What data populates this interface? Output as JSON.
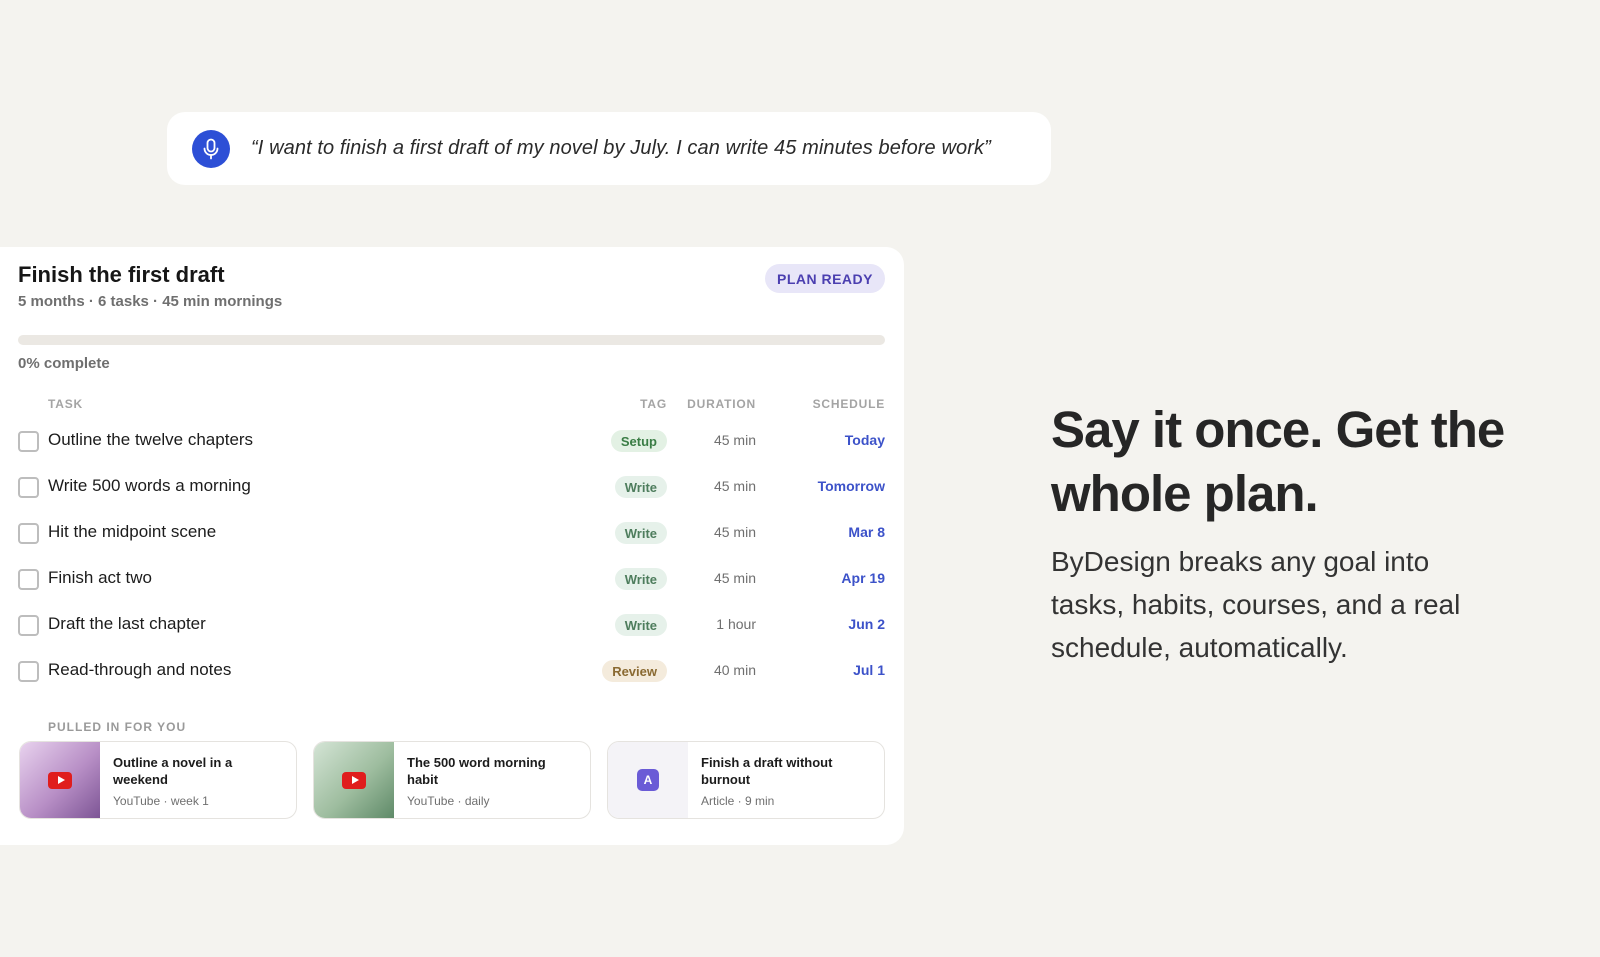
{
  "voice_prompt": {
    "quote": "“I want to finish a first draft of my novel by July. I can write 45 minutes before work”",
    "icon": "microphone-icon",
    "accent_color": "#2d4fd6"
  },
  "plan": {
    "title": "Finish the first draft",
    "meta": "5 months · 6 tasks · 45 min mornings",
    "badge": "PLAN READY",
    "progress_percent": 0,
    "progress_label": "0% complete",
    "columns": {
      "task": "TASK",
      "tag": "TAG",
      "duration": "DURATION",
      "schedule": "SCHEDULE"
    },
    "tasks": [
      {
        "name": "Outline the twelve chapters",
        "tag": "Setup",
        "duration": "45 min",
        "schedule": "Today",
        "done": false
      },
      {
        "name": "Write 500 words a morning",
        "tag": "Write",
        "duration": "45 min",
        "schedule": "Tomorrow",
        "done": false
      },
      {
        "name": "Hit the midpoint scene",
        "tag": "Write",
        "duration": "45 min",
        "schedule": "Mar 8",
        "done": false
      },
      {
        "name": "Finish act two",
        "tag": "Write",
        "duration": "45 min",
        "schedule": "Apr 19",
        "done": false
      },
      {
        "name": "Draft the last chapter",
        "tag": "Write",
        "duration": "1 hour",
        "schedule": "Jun 2",
        "done": false
      },
      {
        "name": "Read-through and notes",
        "tag": "Review",
        "duration": "40 min",
        "schedule": "Jul 1",
        "done": false
      }
    ],
    "pulled_in_label": "PULLED IN FOR YOU",
    "resources": [
      {
        "title": "Outline a novel in a weekend",
        "meta": "YouTube · week 1",
        "icon": "youtube-play-icon"
      },
      {
        "title": "The 500 word morning habit",
        "meta": "YouTube · daily",
        "icon": "youtube-play-icon"
      },
      {
        "title": "Finish a draft without burnout",
        "meta": "Article · 9 min",
        "icon": "article-icon",
        "icon_letter": "A"
      }
    ]
  },
  "marketing": {
    "headline": "Say it once. Get the whole plan.",
    "subtext": "ByDesign breaks any goal into tasks, habits, courses, and a real schedule, automatically."
  }
}
